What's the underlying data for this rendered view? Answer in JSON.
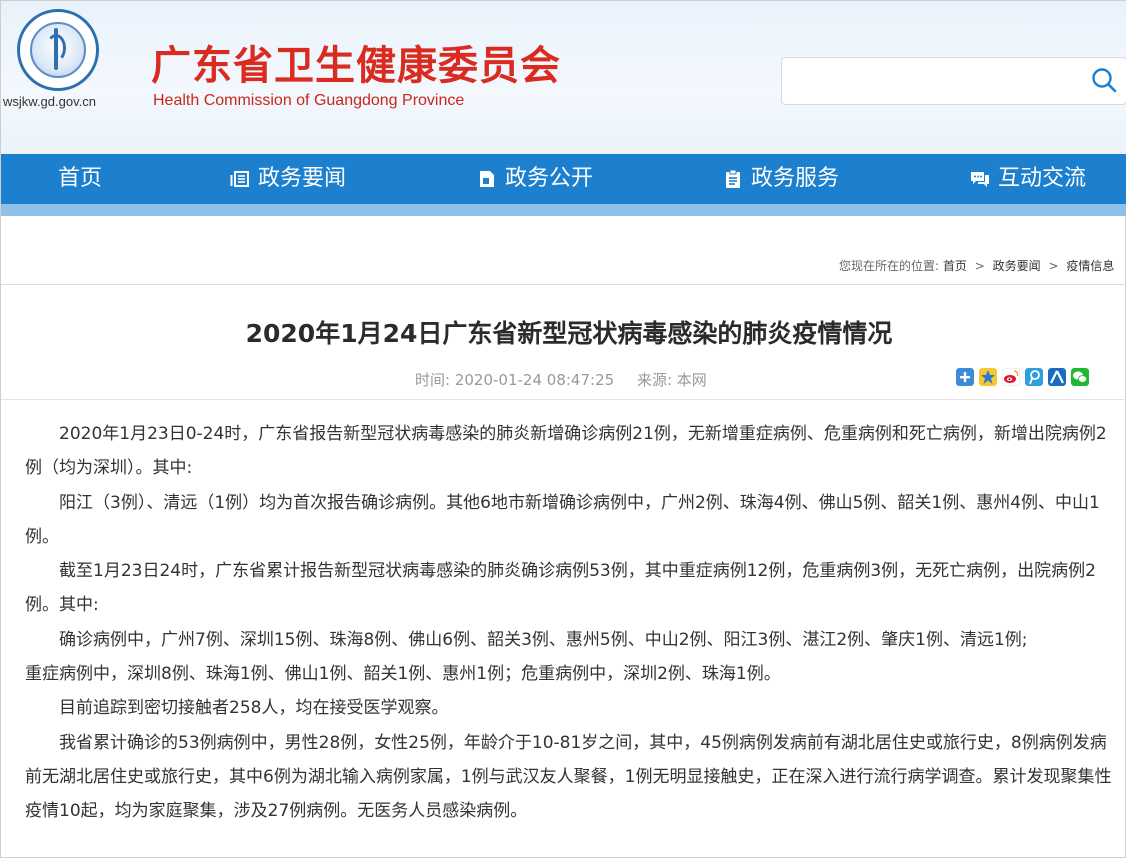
{
  "header": {
    "domain": "wsjkw.gd.gov.cn",
    "title": "广东省卫生健康委员会",
    "subtitle": "Health Commission of Guangdong Province",
    "search_placeholder": ""
  },
  "nav": [
    {
      "label": "首页",
      "icon": "home"
    },
    {
      "label": "政务要闻",
      "icon": "news-icon"
    },
    {
      "label": "政务公开",
      "icon": "document-icon"
    },
    {
      "label": "政务服务",
      "icon": "clipboard-icon"
    },
    {
      "label": "互动交流",
      "icon": "chat-icon"
    }
  ],
  "breadcrumb": {
    "prefix": "您现在所在的位置:",
    "items": [
      "首页",
      "政务要闻",
      "疫情信息"
    ]
  },
  "article": {
    "title": "2020年1月24日广东省新型冠状病毒感染的肺炎疫情情况",
    "time_label": "时间:",
    "time": "2020-01-24 08:47:25",
    "source_label": "来源:",
    "source": "本网",
    "paragraphs": [
      "2020年1月23日0-24时，广东省报告新型冠状病毒感染的肺炎新增确诊病例21例，无新增重症病例、危重病例和死亡病例，新增出院病例2例（均为深圳）。其中:",
      "阳江（3例）、清远（1例）均为首次报告确诊病例。其他6地市新增确诊病例中，广州2例、珠海4例、佛山5例、韶关1例、惠州4例、中山1例。",
      "截至1月23日24时，广东省累计报告新型冠状病毒感染的肺炎确诊病例53例，其中重症病例12例，危重病例3例，无死亡病例，出院病例2例。其中:",
      "确诊病例中，广州7例、深圳15例、珠海8例、佛山6例、韶关3例、惠州5例、中山2例、阳江3例、湛江2例、肇庆1例、清远1例;",
      "重症病例中，深圳8例、珠海1例、佛山1例、韶关1例、惠州1例；危重病例中，深圳2例、珠海1例。",
      "目前追踪到密切接触者258人，均在接受医学观察。",
      "我省累计确诊的53例病例中，男性28例，女性25例，年龄介于10-81岁之间，其中，45例病例发病前有湖北居住史或旅行史，8例病例发病前无湖北居住史或旅行史，其中6例为湖北输入病例家属，1例与武汉友人聚餐，1例无明显接触史，正在深入进行流行病学调查。累计发现聚集性疫情10起，均为家庭聚集，涉及27例病例。无医务人员感染病例。"
    ]
  },
  "share_icons": [
    "plus-share-icon",
    "qzone-icon",
    "weibo-icon",
    "tencent-weibo-icon",
    "renren-icon",
    "wechat-icon"
  ],
  "colors": {
    "nav_bg": "#1d80cf",
    "title_red": "#d92b1f"
  }
}
